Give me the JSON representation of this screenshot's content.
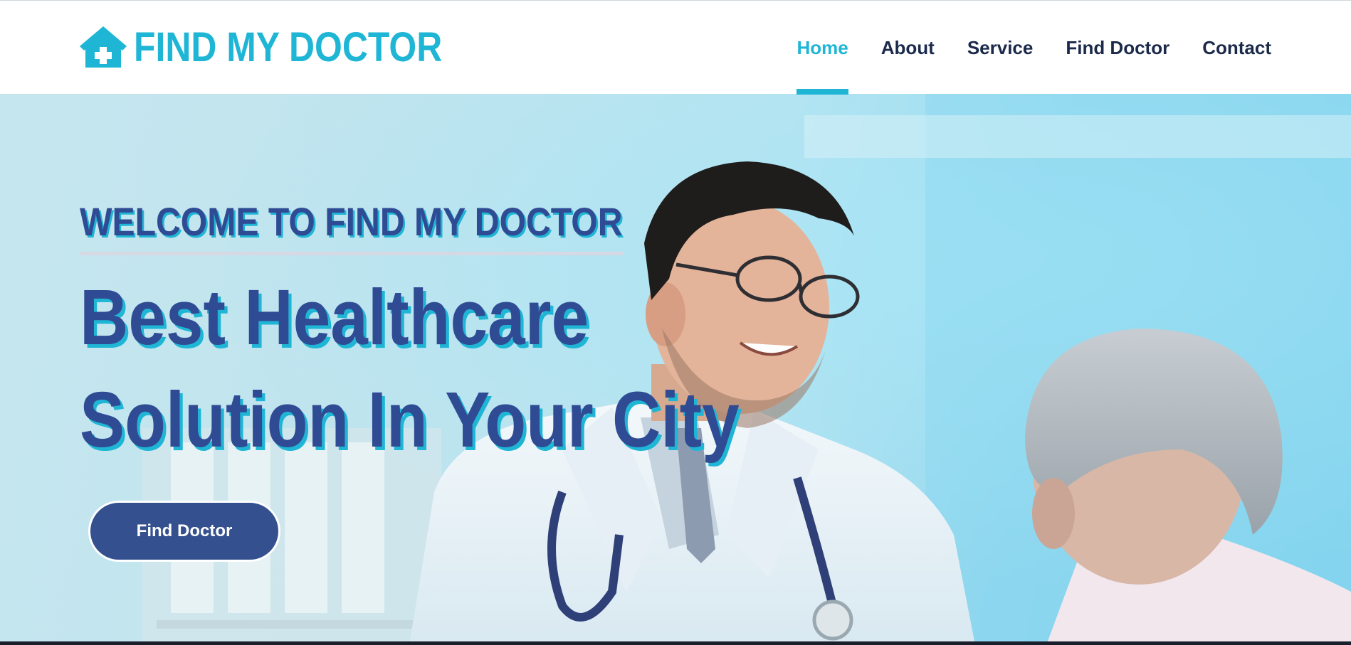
{
  "brand": {
    "name": "FIND MY DOCTOR",
    "icon": "house-medical-icon",
    "color": "#1fb6d6"
  },
  "nav": {
    "items": [
      {
        "label": "Home",
        "active": true
      },
      {
        "label": "About",
        "active": false
      },
      {
        "label": "Service",
        "active": false
      },
      {
        "label": "Find Doctor",
        "active": false
      },
      {
        "label": "Contact",
        "active": false
      }
    ]
  },
  "hero": {
    "kicker": "WELCOME TO FIND MY DOCTOR",
    "title_line1": "Best Healthcare",
    "title_line2": "Solution In Your City",
    "button_label": "Find Doctor",
    "title_color": "#2f4b93",
    "shadow_color": "#1fb6d6"
  }
}
